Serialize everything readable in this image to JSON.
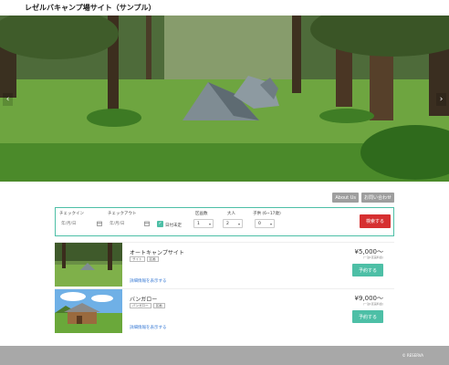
{
  "header": {
    "site_title": "レゼルバキャンプ場サイト（サンプル）"
  },
  "hero": {
    "prev_glyph": "‹",
    "next_glyph": "›",
    "image": "campsite-tents-in-forest"
  },
  "nav": {
    "about_label": "About Us",
    "contact_label": "お問い合わせ"
  },
  "search": {
    "checkin_label": "チェックイン",
    "checkin_placeholder": "年/月/日",
    "checkout_label": "チェックアウト",
    "checkout_placeholder": "年/月/日",
    "undecided_label": "日付未定",
    "sites_label": "区画数",
    "sites_value": "1",
    "adults_label": "大人",
    "adults_value": "2",
    "children_label": "子供 (6~17歳)",
    "children_value": "0",
    "search_button": "検索する"
  },
  "sites": [
    {
      "name": "オートキャンプサイト",
      "tags": [
        "サイト",
        "区画"
      ],
      "price": "¥5,000〜",
      "tax_note": "(一泊1区画料金)",
      "detail_link": "詳細情報を表示する",
      "reserve_button": "予約する"
    },
    {
      "name": "バンガロー",
      "tags": [
        "バンガロー",
        "区画"
      ],
      "price": "¥9,000〜",
      "tax_note": "(一泊1区画料金)",
      "detail_link": "詳細情報を表示する",
      "reserve_button": "予約する"
    }
  ],
  "footer": {
    "copyright": "© RESERVA"
  },
  "colors": {
    "accent": "#4dbfa6",
    "search_button": "#d63031",
    "footer": "#a8a8a8"
  }
}
